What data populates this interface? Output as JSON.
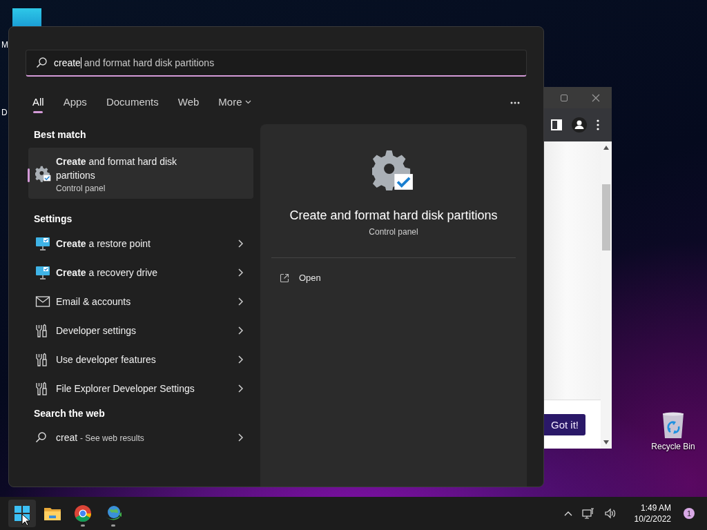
{
  "desktop": {
    "icons": [
      {
        "label": "M",
        "kind": "cut"
      },
      {
        "label": "D",
        "kind": "cut"
      },
      {
        "label": "Recycle Bin",
        "kind": "recycle"
      }
    ]
  },
  "browser_window": {
    "button": "Got it!"
  },
  "search": {
    "value": "create",
    "completion": "and format hard disk partitions"
  },
  "filters": [
    {
      "label": "All",
      "selected": true,
      "kind": "tab"
    },
    {
      "label": "Apps",
      "selected": false,
      "kind": "tab"
    },
    {
      "label": "Documents",
      "selected": false,
      "kind": "tab"
    },
    {
      "label": "Web",
      "selected": false,
      "kind": "tab"
    },
    {
      "label": "More",
      "selected": false,
      "kind": "menu"
    }
  ],
  "best_match": {
    "heading": "Best match",
    "title": "**Create** and format hard disk partitions",
    "subtitle": "Control panel",
    "selected": true
  },
  "settings": {
    "heading": "Settings",
    "items": [
      {
        "label": "**Create** a restore point",
        "kind": "monitor"
      },
      {
        "label": "**Create** a recovery drive",
        "kind": "monitor"
      },
      {
        "label": "Email & accounts",
        "kind": "mail"
      },
      {
        "label": "Developer settings",
        "kind": "tools"
      },
      {
        "label": "Use developer features",
        "kind": "tools"
      },
      {
        "label": "File Explorer Developer Settings",
        "kind": "tools"
      }
    ]
  },
  "web": {
    "heading": "Search the web",
    "query": "creat",
    "suffix": "- See web results"
  },
  "preview": {
    "title": "Create and format hard disk partitions",
    "subtitle": "Control panel",
    "actions": [
      {
        "label": "Open"
      }
    ]
  },
  "taskbar": {
    "apps": [
      {
        "kind": "start",
        "selected": true,
        "running": false
      },
      {
        "kind": "folder",
        "selected": false,
        "running": false
      },
      {
        "kind": "chrome",
        "selected": false,
        "running": true
      },
      {
        "kind": "globe",
        "selected": false,
        "running": true
      }
    ],
    "time": "1:49 AM",
    "date": "10/2/2022",
    "notifications": "1"
  }
}
